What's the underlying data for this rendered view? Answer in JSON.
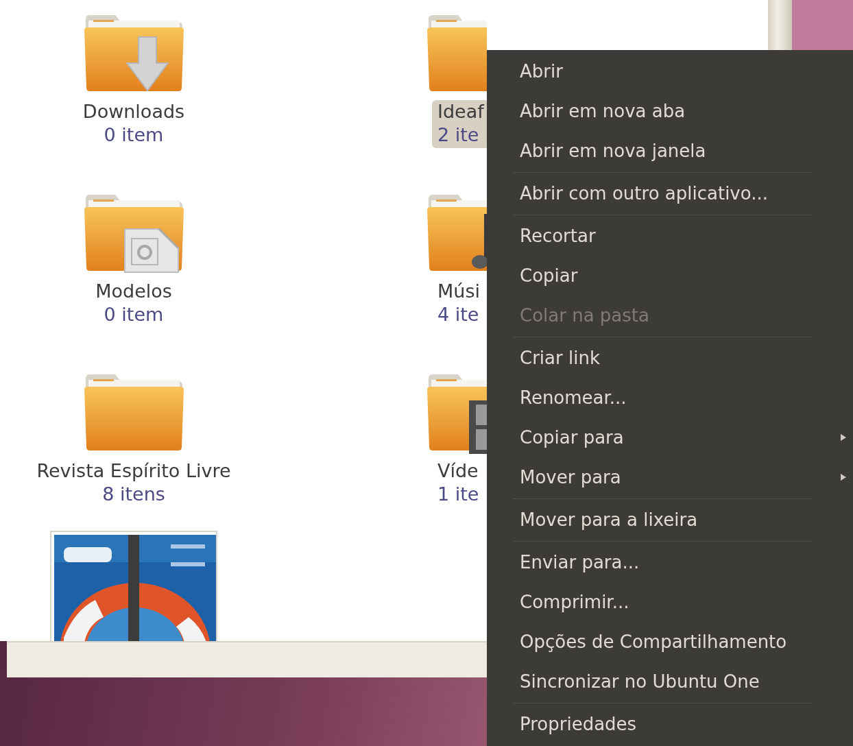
{
  "files": [
    {
      "kind": "download-folder",
      "name": "Downloads",
      "count": "0 item",
      "selected": false
    },
    {
      "kind": "folder",
      "name": "Ideaf",
      "count": "2 ite",
      "selected": true
    },
    {
      "kind": "template-folder",
      "name": "Modelos",
      "count": "0 item",
      "selected": false
    },
    {
      "kind": "music-folder",
      "name": "Músi",
      "count": "4 ite",
      "selected": false
    },
    {
      "kind": "folder",
      "name": "Revista Espírito Livre",
      "count": "8 itens",
      "selected": false
    },
    {
      "kind": "video-folder",
      "name": "Víde",
      "count": "1 ite",
      "selected": false
    },
    {
      "kind": "picture"
    }
  ],
  "context_menu": {
    "items": [
      {
        "label": "Abrir",
        "disabled": false,
        "submenu": false,
        "separator_after": false
      },
      {
        "label": "Abrir em nova aba",
        "disabled": false,
        "submenu": false,
        "separator_after": false
      },
      {
        "label": "Abrir em nova janela",
        "disabled": false,
        "submenu": false,
        "separator_after": true
      },
      {
        "label": "Abrir com outro aplicativo...",
        "disabled": false,
        "submenu": false,
        "separator_after": true
      },
      {
        "label": "Recortar",
        "disabled": false,
        "submenu": false,
        "separator_after": false
      },
      {
        "label": "Copiar",
        "disabled": false,
        "submenu": false,
        "separator_after": false
      },
      {
        "label": "Colar na pasta",
        "disabled": true,
        "submenu": false,
        "separator_after": true
      },
      {
        "label": "Criar link",
        "disabled": false,
        "submenu": false,
        "separator_after": false
      },
      {
        "label": "Renomear...",
        "disabled": false,
        "submenu": false,
        "separator_after": false
      },
      {
        "label": "Copiar para",
        "disabled": false,
        "submenu": true,
        "separator_after": false
      },
      {
        "label": "Mover para",
        "disabled": false,
        "submenu": true,
        "separator_after": true
      },
      {
        "label": "Mover para a lixeira",
        "disabled": false,
        "submenu": false,
        "separator_after": true
      },
      {
        "label": "Enviar para...",
        "disabled": false,
        "submenu": false,
        "separator_after": false
      },
      {
        "label": "Comprimir...",
        "disabled": false,
        "submenu": false,
        "separator_after": false
      },
      {
        "label": "Opções de Compartilhamento",
        "disabled": false,
        "submenu": false,
        "separator_after": false
      },
      {
        "label": "Sincronizar no Ubuntu One",
        "disabled": false,
        "submenu": false,
        "separator_after": true
      },
      {
        "label": "Propriedades",
        "disabled": false,
        "submenu": false,
        "separator_after": false
      }
    ]
  }
}
